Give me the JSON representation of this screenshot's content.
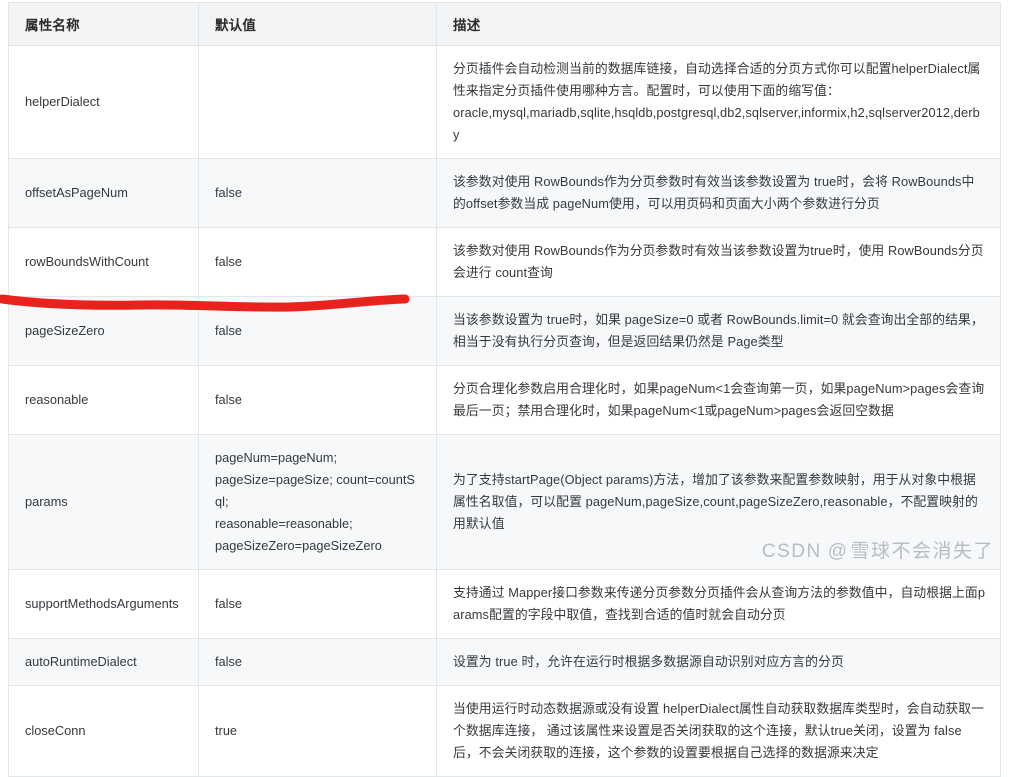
{
  "table": {
    "headers": [
      "属性名称",
      "默认值",
      "描述"
    ],
    "rows": [
      {
        "name": "helperDialect",
        "default": "",
        "description": "分页插件会自动检测当前的数据库链接，自动选择合适的分页方式你可以配置helperDialect属性来指定分页插件使用哪种方言。配置时，可以使用下面的缩写值：\noracle,mysql,mariadb,sqlite,hsqldb,postgresql,db2,sqlserver,informix,h2,sqlserver2012,derby"
      },
      {
        "name": "offsetAsPageNum",
        "default": "false",
        "description": "该参数对使用 RowBounds作为分页参数时有效当该参数设置为 true时，会将 RowBounds中的offset参数当成 pageNum使用，可以用页码和页面大小两个参数进行分页"
      },
      {
        "name": "rowBoundsWithCount",
        "default": "false",
        "description": "该参数对使用 RowBounds作为分页参数时有效当该参数设置为true时，使用 RowBounds分页会进行 count查询"
      },
      {
        "name": "pageSizeZero",
        "default": "false",
        "description": "当该参数设置为 true时，如果 pageSize=0 或者 RowBounds.limit=0 就会查询出全部的结果，相当于没有执行分页查询，但是返回结果仍然是 Page类型"
      },
      {
        "name": "reasonable",
        "default": "false",
        "description": "分页合理化参数启用合理化时，如果pageNum<1会查询第一页，如果pageNum>pages会查询最后一页；禁用合理化时，如果pageNum<1或pageNum>pages会返回空数据"
      },
      {
        "name": "params",
        "default": "pageNum=pageNum;\npageSize=pageSize; count=countSql;\nreasonable=reasonable;\npageSizeZero=pageSizeZero",
        "description": "为了支持startPage(Object params)方法，增加了该参数来配置参数映射，用于从对象中根据属性名取值，可以配置 pageNum,pageSize,count,pageSizeZero,reasonable，不配置映射的用默认值"
      },
      {
        "name": "supportMethodsArguments",
        "default": "false",
        "description": "支持通过 Mapper接口参数来传递分页参数分页插件会从查询方法的参数值中，自动根据上面params配置的字段中取值，查找到合适的值时就会自动分页"
      },
      {
        "name": "autoRuntimeDialect",
        "default": "false",
        "description": "设置为 true 时，允许在运行时根据多数据源自动识别对应方言的分页"
      },
      {
        "name": "closeConn",
        "default": "true",
        "description": "当使用运行时动态数据源或没有设置 helperDialect属性自动获取数据库类型时，会自动获取一个数据库连接， 通过该属性来设置是否关闭获取的这个连接，默认true关闭，设置为 false后，不会关闭获取的连接，这个参数的设置要根据自己选择的数据源来决定"
      }
    ]
  },
  "annotation": {
    "stroke_color": "#e8221c",
    "target_row": "reasonable"
  },
  "watermark": {
    "site": "CSDN",
    "at": "@",
    "author": "雪球不会消失了",
    "color": "#b9bdc2"
  }
}
